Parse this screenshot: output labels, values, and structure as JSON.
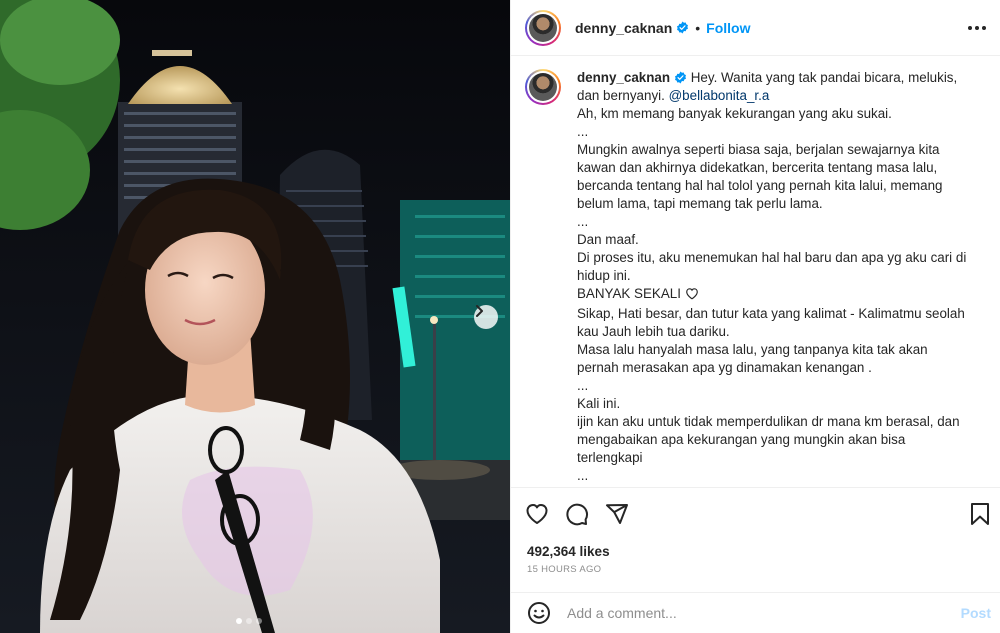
{
  "post": {
    "username": "denny_caknan",
    "follow_label": "Follow",
    "separator": "•",
    "caption_username": "denny_caknan",
    "caption_lines": [
      " Hey. Wanita yang tak pandai bicara, melukis,",
      "dan bernyanyi. ",
      "Ah, km memang banyak kekurangan yang aku sukai.",
      "...",
      "Mungkin awalnya seperti biasa saja, berjalan sewajarnya kita",
      "kawan dan akhirnya didekatkan, bercerita tentang masa lalu,",
      "bercanda tentang hal hal tolol yang pernah kita lalui, memang",
      "belum lama, tapi memang tak perlu lama.",
      "...",
      "Dan maaf.",
      "Di proses itu, aku menemukan hal hal baru dan apa yg aku cari di",
      "hidup ini.",
      "BANYAK SEKALI ",
      "Sikap, Hati besar, dan tutur kata yang kalimat - Kalimatmu seolah",
      "kau Jauh lebih tua dariku.",
      "Masa lalu hanyalah masa lalu, yang tanpanya kita tak akan",
      "pernah merasakan apa yg dinamakan kenangan .",
      "...",
      "Kali ini.",
      "ijin kan aku untuk tidak memperdulikan dr mana km berasal, dan",
      "mengabaikan apa kekurangan yang mungkin akan bisa",
      "terlengkapi",
      "..."
    ],
    "mention": "@bellabonita_r.a",
    "likes": "492,364 likes",
    "time_ago": "15 HOURS AGO",
    "comment_placeholder": "Add a comment...",
    "post_label": "Post"
  },
  "icons": {
    "verified": "verified-badge-icon",
    "more": "more-options-icon",
    "like": "heart-icon",
    "comment": "comment-icon",
    "share": "share-icon",
    "save": "bookmark-icon",
    "emoji": "emoji-icon",
    "next": "chevron-right-icon"
  },
  "colors": {
    "accent": "#0095f6",
    "mention": "#00376b",
    "muted": "#8e8e8e",
    "post_disabled": "#b3dbff"
  },
  "carousel": {
    "slide_count": 3,
    "active_index": 0
  }
}
